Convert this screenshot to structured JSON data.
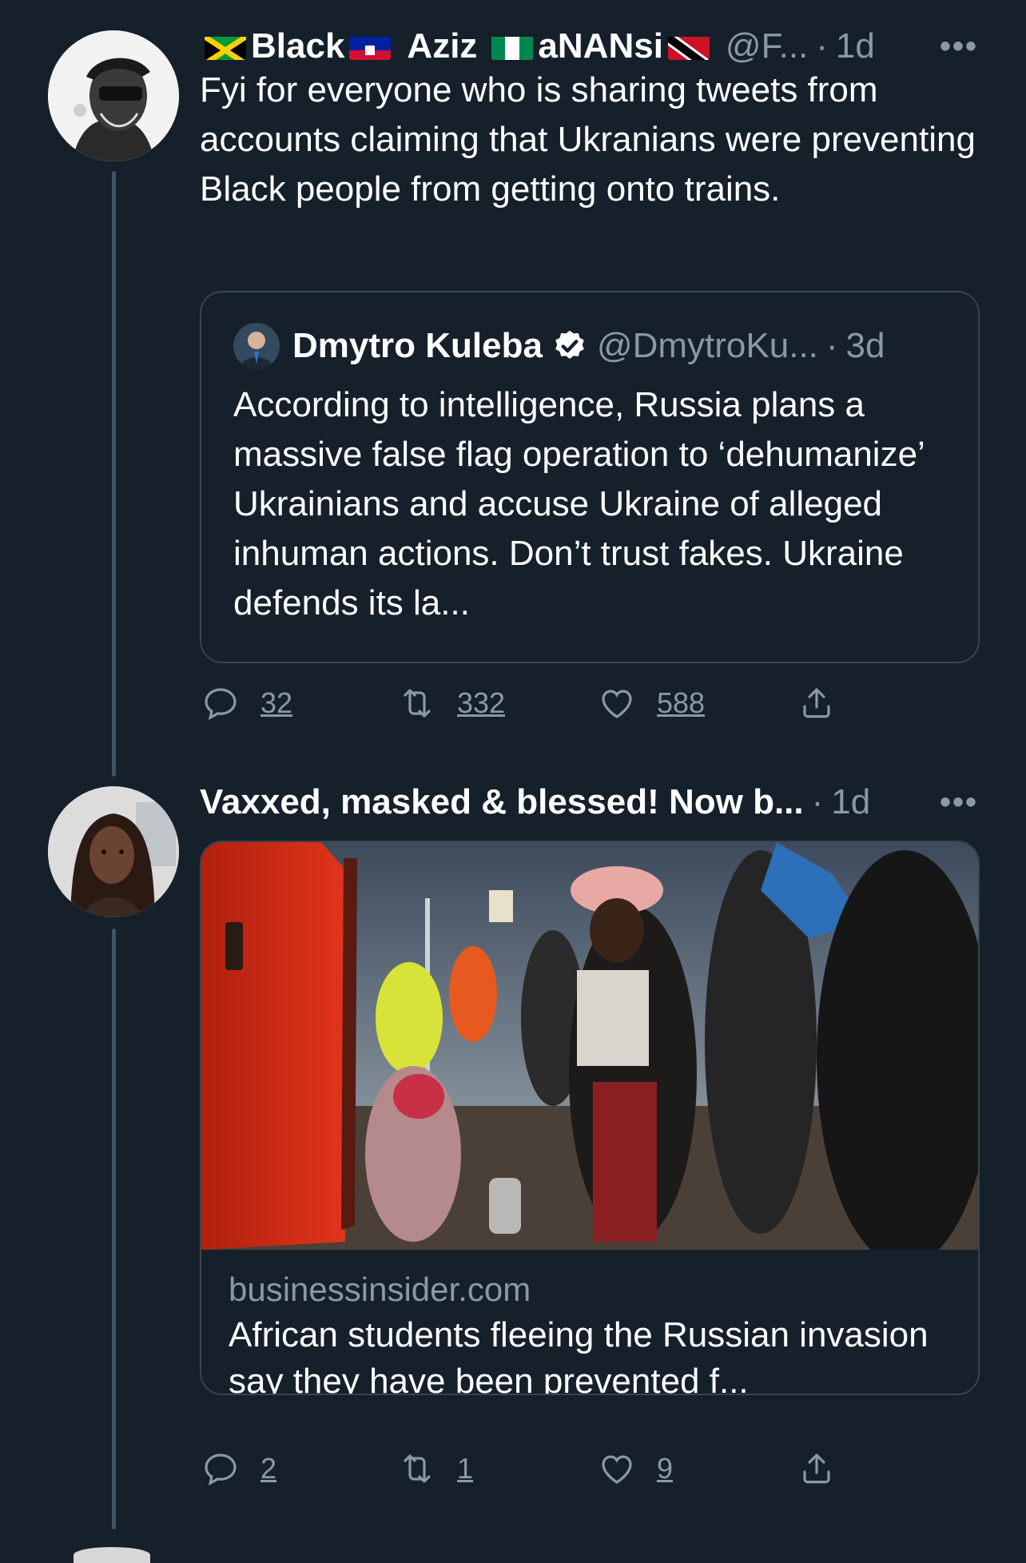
{
  "tweet1": {
    "name_parts": [
      "Black",
      "Aziz",
      "aNANsi"
    ],
    "handle": "@F...",
    "dot": "·",
    "time": "1d",
    "more": "•••",
    "text": "Fyi for everyone who is sharing tweets from accounts claiming that Ukranians were preventing Black people from getting onto trains.",
    "quote": {
      "name": "Dmytro Kuleba",
      "handle": "@DmytroKu...",
      "dot": "·",
      "time": "3d",
      "text": "According to intelligence, Russia plans a massive false flag operation to ‘dehumanize’ Ukrainians and accuse Ukraine of alleged inhuman actions. Don’t trust fakes. Ukraine defends its la..."
    },
    "actions": {
      "replies": "32",
      "retweets": "332",
      "likes": "588"
    }
  },
  "tweet2": {
    "name": "Vaxxed, masked & blessed! Now b...",
    "dot": "·",
    "time": "1d",
    "more": "•••",
    "card": {
      "domain": "businessinsider.com",
      "title": "African students fleeing the Russian invasion say they have been prevented f..."
    },
    "actions": {
      "replies": "2",
      "retweets": "1",
      "likes": "9"
    }
  },
  "icons": [
    "reply-icon",
    "retweet-icon",
    "like-icon",
    "share-icon",
    "verified-icon"
  ],
  "colors": {
    "background": "#15202b",
    "secondary_text": "#8b98a5",
    "border": "#38444d"
  }
}
